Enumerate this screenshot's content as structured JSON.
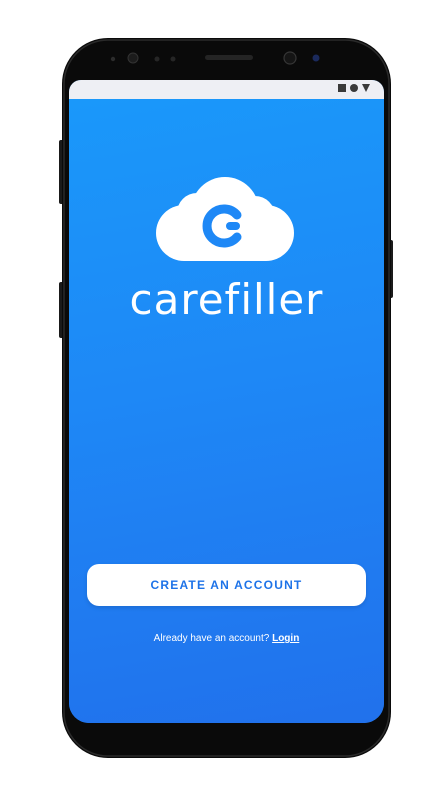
{
  "status_bar": {
    "icons": [
      "stop-square-icon",
      "circle-dot-icon",
      "triangle-down-icon"
    ]
  },
  "app": {
    "brand_name": "carefiller",
    "logo_icon": "cloud-c-logo-icon",
    "cta_label": "CREATE AN ACCOUNT",
    "login_prompt": "Already have an account?",
    "login_link": "Login"
  },
  "colors": {
    "gradient_top": "#1a98fa",
    "gradient_bottom": "#2171ec",
    "cta_text": "#1e73e8",
    "cta_background": "#ffffff",
    "phone_body": "#0a0a0a"
  }
}
